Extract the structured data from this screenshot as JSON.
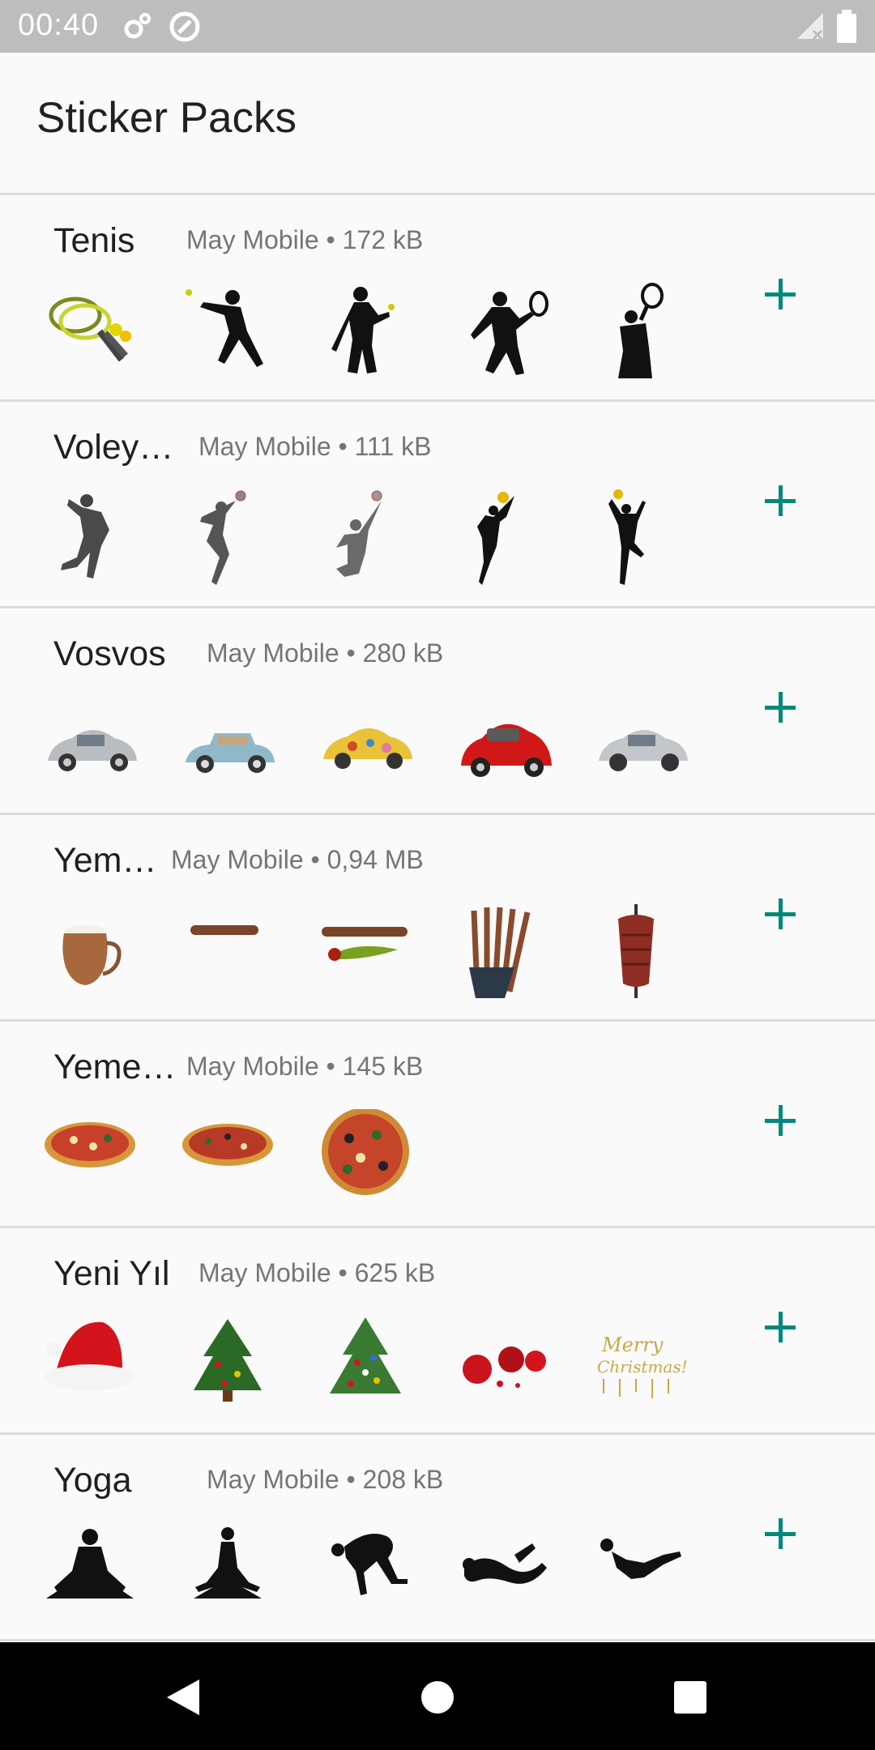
{
  "status": {
    "time": "00:40"
  },
  "app_bar": {
    "title": "Sticker Packs"
  },
  "colors": {
    "accent": "#00897b",
    "status_bar": "#bdbdbd"
  },
  "packs": [
    {
      "name": "Tenis",
      "publisher": "May Mobile",
      "size": "172 kB",
      "stickers": [
        "tennis-rackets-sticker",
        "tennis-player-sticker",
        "tennis-player-sticker",
        "tennis-player-sticker",
        "tennis-player-sticker"
      ]
    },
    {
      "name": "Voley…",
      "publisher": "May Mobile",
      "size": "111 kB",
      "stickers": [
        "volleyball-player-sticker",
        "volleyball-player-sticker",
        "volleyball-player-sticker",
        "volleyball-player-sticker",
        "volleyball-player-sticker"
      ]
    },
    {
      "name": "Vosvos",
      "publisher": "May Mobile",
      "size": "280 kB",
      "stickers": [
        "beetle-car-sticker",
        "beetle-car-sticker",
        "beetle-car-sticker",
        "beetle-car-sticker",
        "beetle-car-sticker"
      ]
    },
    {
      "name": "Yem…",
      "publisher": "May Mobile",
      "size": "0,94 MB",
      "stickers": [
        "ayran-jug-sticker",
        "kebab-sticker",
        "kebab-pepper-sticker",
        "kebab-skewers-sticker",
        "doner-sticker"
      ]
    },
    {
      "name": "Yeme…",
      "publisher": "May Mobile",
      "size": "145 kB",
      "stickers": [
        "pizza-slice-sticker",
        "pizza-flat-sticker",
        "pizza-round-sticker"
      ]
    },
    {
      "name": "Yeni Yıl",
      "publisher": "May Mobile",
      "size": "625 kB",
      "stickers": [
        "santa-hat-sticker",
        "christmas-tree-sticker",
        "christmas-tree-sticker",
        "ornaments-sticker",
        "merry-christmas-sticker"
      ]
    },
    {
      "name": "Yoga",
      "publisher": "May Mobile",
      "size": "208 kB",
      "stickers": [
        "yoga-pose-sticker",
        "yoga-pose-sticker",
        "yoga-pose-sticker",
        "yoga-pose-sticker",
        "yoga-pose-sticker"
      ]
    }
  ]
}
